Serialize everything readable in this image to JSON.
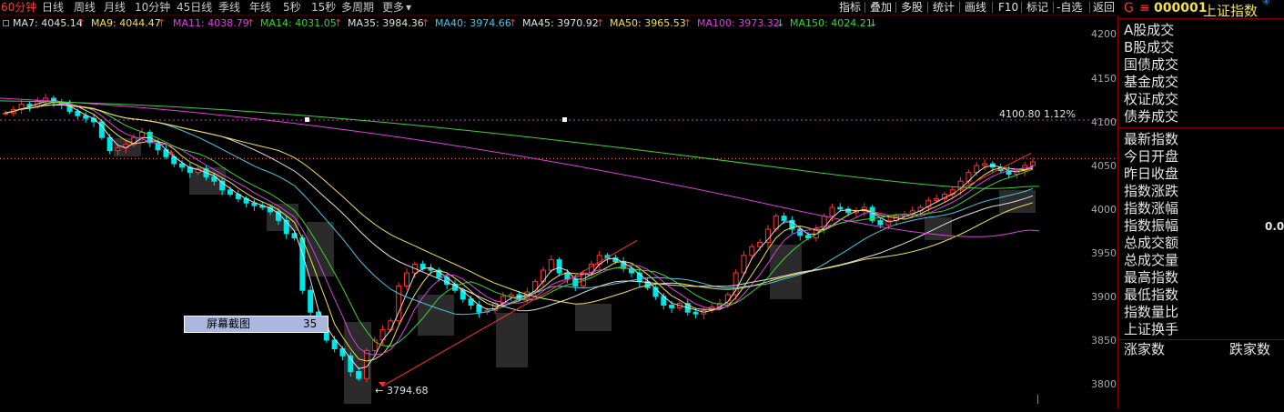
{
  "tabs": [
    "60分钟",
    "日线",
    "周线",
    "月线",
    "10分钟",
    "45日线",
    "季线",
    "年线",
    "5秒",
    "15秒",
    "多周期",
    "更多"
  ],
  "active_tab_index": 0,
  "toolbar": [
    "指标",
    "叠加",
    "多股",
    "统计",
    "画线",
    "F10",
    "标记",
    "-自选",
    "返回"
  ],
  "ma_legend": [
    {
      "label": "MA7: 4045.14",
      "arrow": "↑",
      "color": "#e0e0e0"
    },
    {
      "label": "MA9: 4044.47",
      "arrow": "↑",
      "color": "#f2e24a"
    },
    {
      "label": "MA11: 4038.79",
      "arrow": "↑",
      "color": "#e040e0"
    },
    {
      "label": "MA14: 4031.05",
      "arrow": "↑",
      "color": "#3cd23c"
    },
    {
      "label": "MA35: 3984.36",
      "arrow": "↑",
      "color": "#e0e0e0"
    },
    {
      "label": "MA40: 3974.66",
      "arrow": "↑",
      "color": "#46c8e6"
    },
    {
      "label": "MA45: 3970.92",
      "arrow": "↑",
      "color": "#e0e0e0"
    },
    {
      "label": "MA50: 3965.53",
      "arrow": "↑",
      "color": "#f2e24a"
    },
    {
      "label": "MA100: 3973.32",
      "arrow": "↓",
      "color": "#e040e0"
    },
    {
      "label": "MA150: 4024.21",
      "arrow": "↓",
      "color": "#3cd23c"
    }
  ],
  "y_axis_labels": [
    "4200",
    "4150",
    "4100",
    "4050",
    "4000",
    "3950",
    "3900",
    "3850",
    "3800"
  ],
  "annotations": {
    "ref_line_label": "4100.80 1.12%",
    "low_label": "3794.68"
  },
  "screenshot_tip": {
    "label": "屏幕截图",
    "count": "35"
  },
  "right_panel": {
    "g_label": "G",
    "eq": "≡",
    "code": "000001",
    "name": "上证指数",
    "circle": "④",
    "group1": [
      "A股成交",
      "B股成交",
      "国债成交",
      "基金成交",
      "权证成交",
      "债券成交"
    ],
    "group2": [
      "最新指数",
      "今日开盘",
      "昨日收盘",
      "指数涨跌",
      "指数涨幅",
      "指数振幅",
      "总成交额",
      "总成交量",
      "最高指数",
      "最低指数",
      "指数量比",
      "上证换手"
    ],
    "zero_value": "0.0",
    "bottom_left": "涨家数",
    "bottom_right": "跌家数"
  },
  "colors": {
    "up": "#ff3232",
    "down": "#00e6e6",
    "grid_red": "#8a0000",
    "ref_magenta": "#c03cc0"
  }
}
